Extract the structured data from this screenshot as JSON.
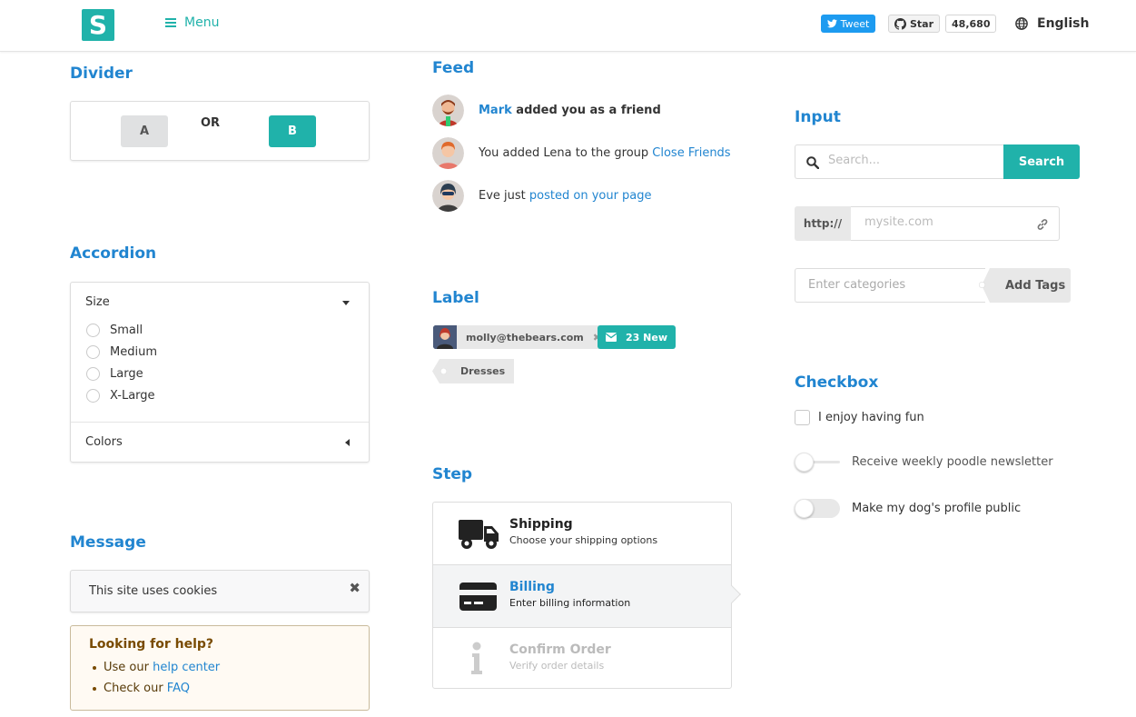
{
  "colors": {
    "accent": "#20b2aa",
    "heading": "#2185d0",
    "link": "#2185d0"
  },
  "header": {
    "logo_letter": "S",
    "menu_label": "Menu",
    "tweet_label": "Tweet",
    "star_label": "Star",
    "star_count": "48,680",
    "language": "English"
  },
  "divider": {
    "title": "Divider",
    "a_label": "A",
    "or_label": "OR",
    "b_label": "B"
  },
  "accordion": {
    "title": "Accordion",
    "section1_title": "Size",
    "options": [
      "Small",
      "Medium",
      "Large",
      "X-Large"
    ],
    "section2_title": "Colors"
  },
  "message": {
    "title": "Message",
    "cookie_text": "This site uses cookies",
    "help_header": "Looking for help?",
    "items": [
      {
        "prefix": "Use our ",
        "link": "help center"
      },
      {
        "prefix": "Check our ",
        "link": "FAQ"
      }
    ]
  },
  "feed": {
    "title": "Feed",
    "events": [
      {
        "user": "Mark",
        "text": " added you as a friend"
      },
      {
        "text": "You added Lena to the group ",
        "link": "Close Friends"
      },
      {
        "text": "Eve just ",
        "link": "posted on your page"
      }
    ]
  },
  "label": {
    "title": "Label",
    "user_email": "molly@thebears.com",
    "new_count": "23",
    "new_text": "New",
    "tag": "Dresses"
  },
  "step": {
    "title": "Step",
    "steps": [
      {
        "title": "Shipping",
        "desc": "Choose your shipping options",
        "state": "completed",
        "icon": "truck-icon"
      },
      {
        "title": "Billing",
        "desc": "Enter billing information",
        "state": "active",
        "icon": "credit-card-icon"
      },
      {
        "title": "Confirm Order",
        "desc": "Verify order details",
        "state": "disabled",
        "icon": "info-icon"
      }
    ]
  },
  "input": {
    "title": "Input",
    "search_placeholder": "Search...",
    "search_button": "Search",
    "url_prefix": "http://",
    "url_placeholder": "mysite.com",
    "categories_placeholder": "Enter categories",
    "add_tags_label": "Add Tags"
  },
  "checkbox": {
    "title": "Checkbox",
    "checkbox_label": "I enjoy having fun",
    "slider_label": "Receive weekly poodle newsletter",
    "toggle_label": "Make my dog's profile public"
  }
}
